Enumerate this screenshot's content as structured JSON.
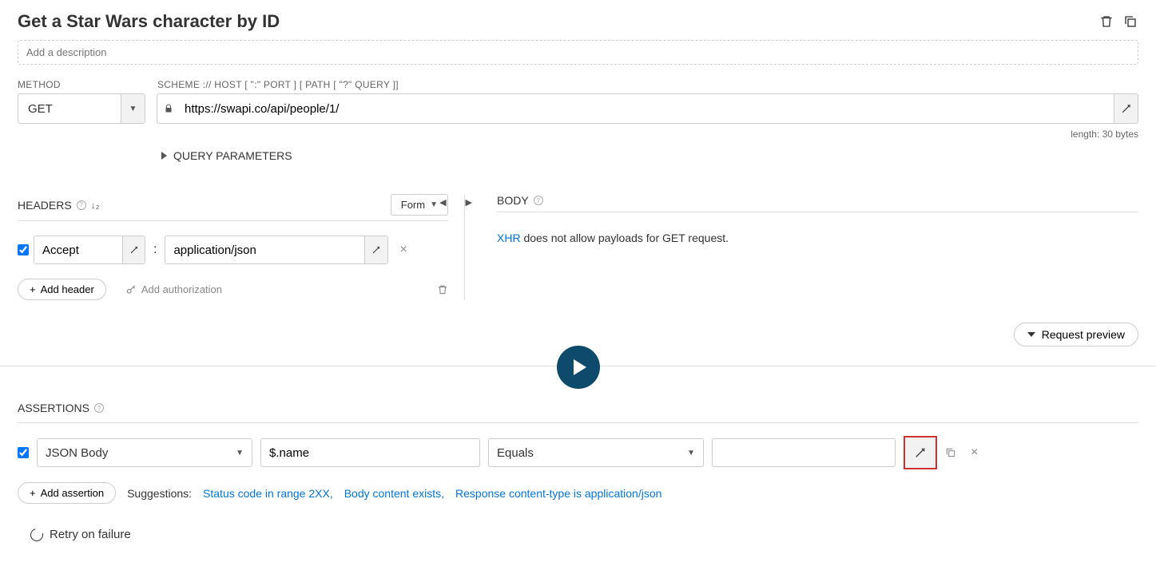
{
  "title": "Get a Star Wars character by ID",
  "description_placeholder": "Add a description",
  "labels": {
    "method": "METHOD",
    "url": "SCHEME :// HOST [ \":\" PORT ] [ PATH [ \"?\" QUERY ]]",
    "headers": "HEADERS",
    "body": "BODY",
    "assertions": "ASSERTIONS",
    "suggestions": "Suggestions:"
  },
  "method": "GET",
  "url": "https://swapi.co/api/people/1/",
  "length_text": "length: 30 bytes",
  "query_params": "QUERY PARAMETERS",
  "form_toggle": "Form",
  "headers_list": [
    {
      "name": "Accept",
      "value": "application/json"
    }
  ],
  "add_header": "Add header",
  "add_auth": "Add authorization",
  "body_prefix": "XHR",
  "body_text": " does not allow payloads for GET request.",
  "request_preview": "Request preview",
  "assertion": {
    "source": "JSON Body",
    "path": "$.name",
    "operator": "Equals",
    "value": ""
  },
  "add_assertion": "Add assertion",
  "suggestions": [
    "Status code in range 2XX",
    "Body content exists",
    "Response content-type is application/json"
  ],
  "retry": "Retry on failure"
}
